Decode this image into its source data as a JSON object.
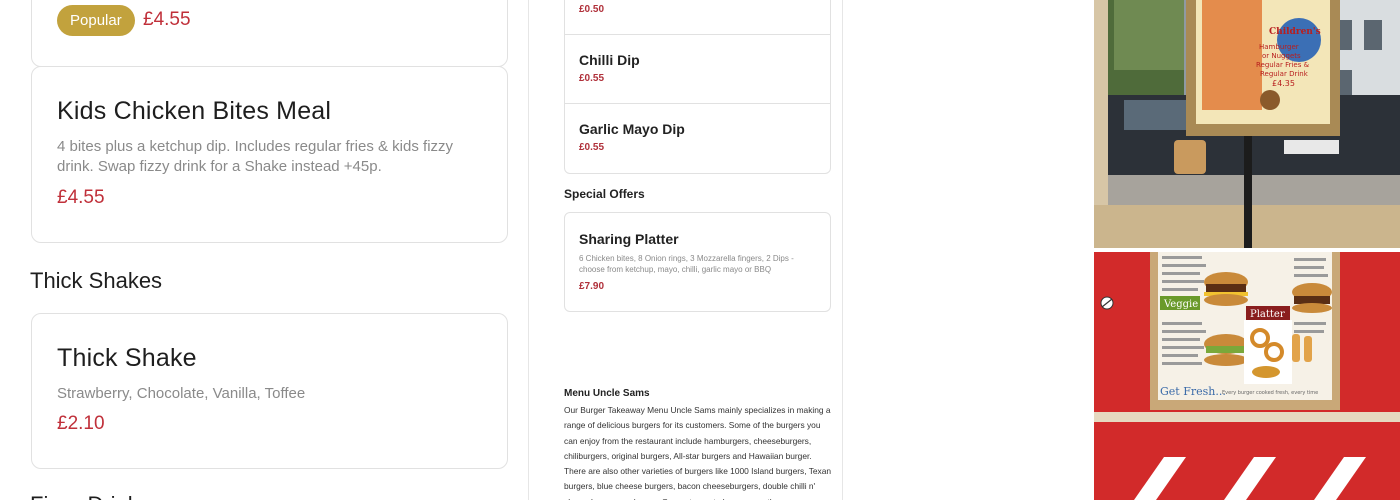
{
  "left": {
    "top_card": {
      "badge": "Popular",
      "price": "£4.55"
    },
    "kids_meal": {
      "title": "Kids Chicken Bites Meal",
      "description": "4 bites plus a ketchup dip. Includes regular fries & kids fizzy drink. Swap fizzy drink for a Shake instead +45p.",
      "price": "£4.55"
    },
    "thick_shakes_heading": "Thick Shakes",
    "thick_shake": {
      "title": "Thick Shake",
      "description": "Strawberry, Chocolate, Vanilla, Toffee",
      "price": "£2.10"
    },
    "fizzy_heading": "Fizzy Drinks"
  },
  "middle": {
    "top_price": "£0.50",
    "chilli_dip": {
      "title": "Chilli Dip",
      "price": "£0.55"
    },
    "garlic_mayo_dip": {
      "title": "Garlic Mayo Dip",
      "price": "£0.55"
    },
    "special_offers_heading": "Special Offers",
    "sharing_platter": {
      "title": "Sharing Platter",
      "description": "6 Chicken bites, 8 Onion rings, 3 Mozzarella fingers, 2 Dips - choose from ketchup, mayo, chilli, garlic mayo or BBQ",
      "price": "£7.90"
    },
    "about": {
      "title": "Menu Uncle Sams",
      "text": "Our Burger Takeaway Menu Uncle Sams mainly specializes in making a range of delicious burgers for its customers. Some of the burgers you can enjoy from the restaurant include hamburgers, cheeseburgers, chiliburgers, original burgers, All-star burgers and Hawaiian burger. There are also other varieties of burgers like 1000 Island burgers, Texan burgers, blue cheese burgers, bacon cheeseburgers, double chilli n' cheeseburgers and more. Our restaurant also serves other"
    }
  },
  "photos": {
    "sign_1": {
      "line1": "Children's",
      "line2": "Hamburger",
      "line3": "or Nuggets",
      "line4": "Regular Fries &",
      "line5": "Regular Drink",
      "price": "£4.35"
    },
    "sign_2": {
      "veggie": "Veggie",
      "platter": "Platter",
      "fresh": "Get Fresh...",
      "tagline": "Every burger cooked fresh, every time"
    }
  },
  "colors": {
    "price_red": "#c0303a",
    "badge_gold": "#c2a23d",
    "photo_red": "#d22a2a"
  }
}
